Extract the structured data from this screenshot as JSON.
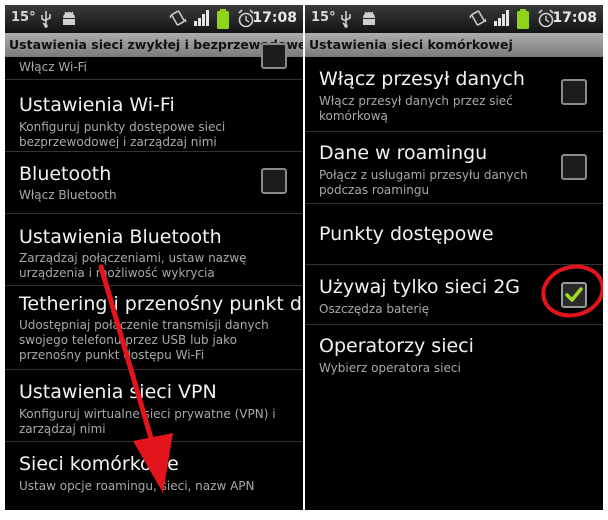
{
  "status_bar": {
    "temperature": "15°",
    "time": "17:08"
  },
  "left_screen": {
    "title": "Ustawienia sieci zwykłej i bezprzewodowej",
    "items": [
      {
        "title": "",
        "subtitle": "Włącz Wi-Fi"
      },
      {
        "title": "Ustawienia Wi-Fi",
        "subtitle": "Konfiguruj punkty dostępowe sieci bezprzewodowej i zarządzaj nimi"
      },
      {
        "title": "Bluetooth",
        "subtitle": "Włącz Bluetooth"
      },
      {
        "title": "Ustawienia Bluetooth",
        "subtitle": "Zarządzaj połączeniami, ustaw nazwę urządzenia i możliwość wykrycia"
      },
      {
        "title": "Tethering i przenośny punkt d",
        "subtitle": "Udostępniaj połączenie transmisji danych swojego telefonu przez USB lub jako przenośny punkt dostępu Wi-Fi"
      },
      {
        "title": "Ustawienia sieci VPN",
        "subtitle": "Konfiguruj wirtualne sieci prywatne (VPN) i zarządzaj nimi"
      },
      {
        "title": "Sieci komórkowe",
        "subtitle": "Ustaw opcje roamingu, sieci, nazw APN"
      }
    ]
  },
  "right_screen": {
    "title": "Ustawienia sieci komórkowej",
    "items": [
      {
        "title": "Włącz przesył danych",
        "subtitle": "Włącz przesył danych przez sieć komórkową"
      },
      {
        "title": "Dane w roamingu",
        "subtitle": "Połącz z usługami przesyłu danych podczas roamingu"
      },
      {
        "title": "Punkty dostępowe",
        "subtitle": ""
      },
      {
        "title": "Używaj tylko sieci 2G",
        "subtitle": "Oszczędza baterię"
      },
      {
        "title": "Operatorzy sieci",
        "subtitle": "Wybierz operatora sieci"
      }
    ]
  },
  "annotation_color": "#e3141c",
  "checkmark_color": "#9fdc1e"
}
